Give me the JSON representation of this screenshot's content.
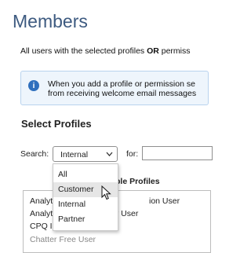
{
  "page": {
    "title": "Members",
    "description_prefix": "All users with the selected profiles ",
    "description_bold": "OR",
    "description_suffix": " permiss"
  },
  "info": {
    "icon": "info-icon",
    "line1": "When you add a profile or permission se",
    "line2": "from receiving welcome email messages"
  },
  "select_profiles": {
    "title": "Select Profiles",
    "search_label": "Search:",
    "search_value": "Internal",
    "for_label": "for:",
    "for_value": "",
    "dropdown_options": [
      "All",
      "Customer",
      "Internal",
      "Partner"
    ],
    "hovered_option": "Customer",
    "available_header_partial": "ble Profiles",
    "available_items": [
      {
        "left": "Analyt",
        "right": "ion User"
      },
      {
        "left": "Analyt",
        "right": "y User"
      },
      {
        "left": "CPQ In",
        "right": ""
      },
      {
        "left": "Chatter Free User",
        "right": ""
      }
    ]
  },
  "colors": {
    "title": "#3d5a80",
    "info_bg": "#eef5fc",
    "info_icon": "#2f6fbd"
  }
}
